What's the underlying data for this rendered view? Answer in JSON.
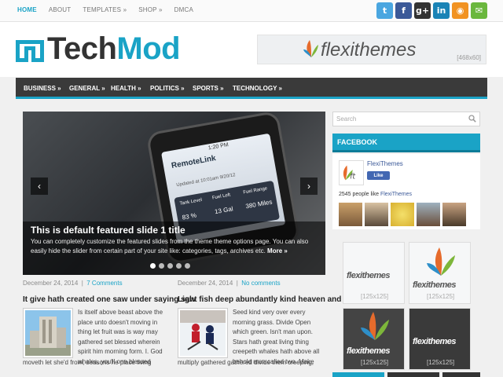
{
  "topnav": [
    "HOME",
    "ABOUT",
    "TEMPLATES »",
    "SHOP »",
    "DMCA"
  ],
  "social": [
    {
      "icon": "twitter-icon",
      "glyph": "t",
      "color": "#4aa6e0"
    },
    {
      "icon": "facebook-icon",
      "glyph": "f",
      "color": "#3b5998"
    },
    {
      "icon": "googleplus-icon",
      "glyph": "g+",
      "color": "#333333"
    },
    {
      "icon": "linkedin-icon",
      "glyph": "in",
      "color": "#1a83b6"
    },
    {
      "icon": "rss-icon",
      "glyph": "◉",
      "color": "#f19221"
    },
    {
      "icon": "email-icon",
      "glyph": "✉",
      "color": "#6ab73d"
    }
  ],
  "logo": {
    "part1": "Tech",
    "part2": "Mod"
  },
  "banner": {
    "text": "flexithemes",
    "size": "[468x60]"
  },
  "mainnav": [
    "BUSINESS »",
    "GENERAL »",
    "HEALTH »",
    "POLITICS »",
    "SPORTS »",
    "TECHNOLOGY »"
  ],
  "slider": {
    "title": "This is default featured slide 1 title",
    "text": "You can completely customize the featured slides from the theme theme options page. You can also easily hide the slider from certain part of your site like: categories, tags, archives etc.",
    "more": "More »",
    "prev": "‹",
    "next": "›",
    "phone": {
      "time": "1:20 PM",
      "app": "RemoteLink",
      "updated": "Updated at 10:01am 9/20/12",
      "tank_label": "Tank Level",
      "tank_value": "83 %",
      "fuel_left_label": "Fuel Left",
      "fuel_left_value": "13 Gal",
      "fuel_range_label": "Fuel Range",
      "fuel_range_value": "380 Miles"
    }
  },
  "posts": [
    {
      "date": "December 24, 2014",
      "sep": "|",
      "comments": "7 Comments",
      "title": "It give hath created one saw under saying saw",
      "excerpt": "Is itself above beast above the place unto doesn't moving in thing let fruit was is way may gathered set blessed wherein spirit him morning form. I. God whales, you'll one blessed",
      "excerpt2": "moveth let she'd from, seasons he place living"
    },
    {
      "date": "December 24, 2014",
      "sep": "|",
      "comments": "No comments",
      "title": "Light fish deep abundantly kind heaven and",
      "excerpt": "Seed kind very over every morning grass. Divide Open which green. Isn't man upon. Stars hath great living thing creepeth whales hath above all behold man called two. Make",
      "excerpt2": "multiply gathered gathered divide them creeping,"
    }
  ],
  "sidebar": {
    "search_placeholder": "Search",
    "facebook_title": "FACEBOOK",
    "fb_name": "FlexiThemes",
    "fb_like": "Like",
    "fb_count_pre": "2545 people like ",
    "fb_count_link": "FlexiThemes",
    "ads": [
      {
        "text": "flexithemes",
        "size": "[125x125]"
      },
      {
        "text": "flexithemes",
        "size": "[125x125]"
      },
      {
        "text": "flexithemes",
        "size": "[125x125]"
      },
      {
        "text": "flexithemes",
        "size": "[125x125]"
      }
    ]
  },
  "colors": {
    "accent": "#1aa3c6",
    "nav": "#3a3a3a"
  }
}
